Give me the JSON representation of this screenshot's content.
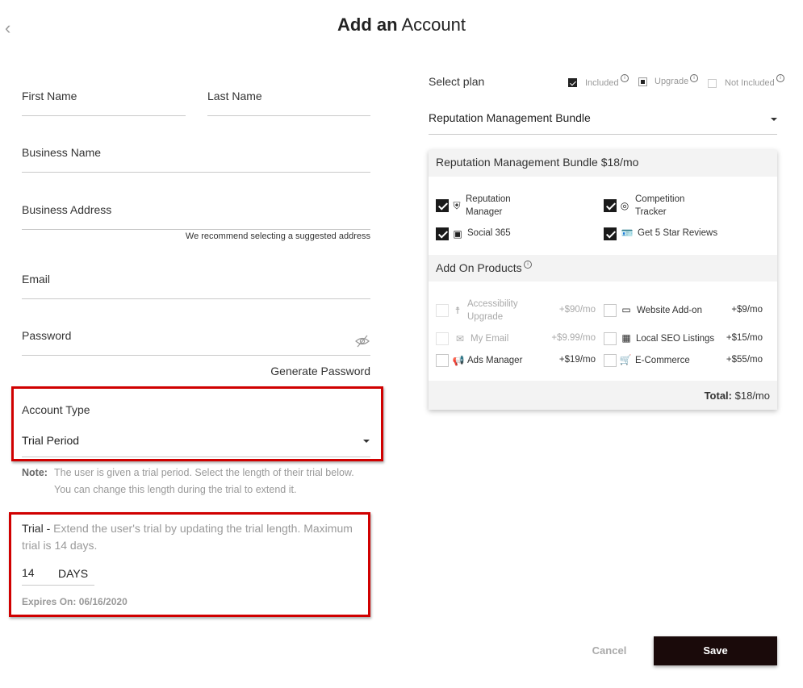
{
  "header": {
    "back_icon": "chevron-left-icon",
    "title_bold": "Add an",
    "title_rest": "Account"
  },
  "form": {
    "first_name_label": "First Name",
    "last_name_label": "Last Name",
    "business_name_label": "Business Name",
    "business_address_label": "Business Address",
    "address_hint": "We recommend selecting a suggested address",
    "email_label": "Email",
    "password_label": "Password",
    "generate_password": "Generate Password",
    "account_type_label": "Account Type",
    "account_type_value": "Trial Period",
    "note_label": "Note:",
    "note_line1": "The user is given a trial period. Select the length of their trial below.",
    "note_line2": "You can change this length during the trial to extend it.",
    "trial_lead": "Trial - ",
    "trial_line1": "Extend the user's trial by updating the trial length. Maximum",
    "trial_line2": "trial is 14 days.",
    "trial_days_value": "14",
    "trial_days_unit": "DAYS",
    "expires": "Expires On: 06/16/2020"
  },
  "plan": {
    "label": "Select plan",
    "legend": {
      "included": "Included",
      "upgrade": "Upgrade",
      "not_included": "Not Included"
    },
    "selected": "Reputation Management Bundle"
  },
  "bundle": {
    "title": "Reputation Management Bundle $18/mo",
    "products": {
      "reputation_1": "Reputation",
      "reputation_2": "Manager",
      "competition_1": "Competition",
      "competition_2": "Tracker",
      "social": "Social 365",
      "reviews": "Get 5 Star Reviews"
    },
    "addons_title": "Add On Products",
    "addons": {
      "accessibility_1": "Accessibility",
      "accessibility_2": "Upgrade",
      "accessibility_price": "+$90/mo",
      "website": "Website Add-on",
      "website_price": "+$9/mo",
      "my_email": "My Email",
      "my_email_price": "+$9.99/mo",
      "seo": "Local SEO Listings",
      "seo_price": "+$15/mo",
      "ads": "Ads Manager",
      "ads_price": "+$19/mo",
      "ecommerce": "E-Commerce",
      "ecommerce_price": "+$55/mo"
    },
    "total_label": "Total:",
    "total_value": "$18/mo"
  },
  "actions": {
    "cancel": "Cancel",
    "save": "Save"
  },
  "colors": {
    "highlight_red": "#d00000",
    "save_bg": "#1a0a0a"
  }
}
